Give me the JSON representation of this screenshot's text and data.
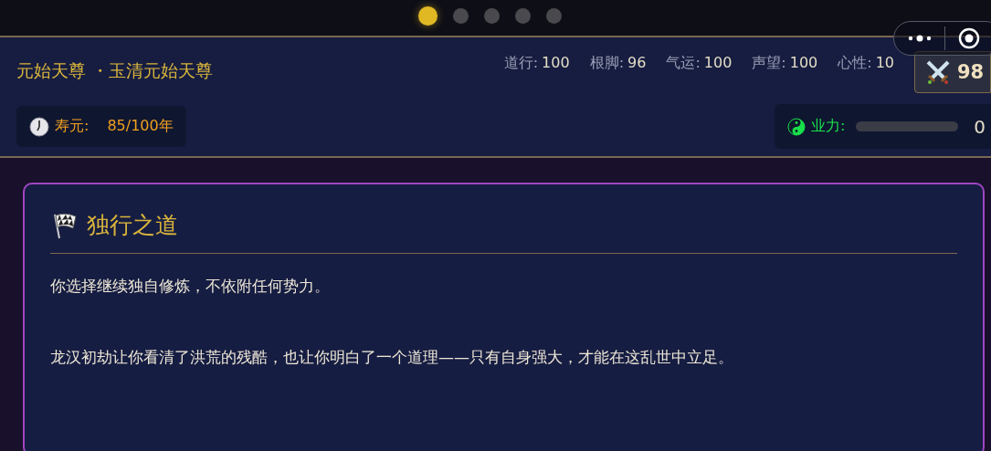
{
  "pager": {
    "pages": [
      {
        "selected": true
      },
      {
        "selected": false
      },
      {
        "selected": false
      },
      {
        "selected": false
      },
      {
        "selected": false
      }
    ]
  },
  "header": {
    "title": "元始天尊 ・玉清元始天尊",
    "stats": [
      {
        "label": "道行:",
        "value": "100"
      },
      {
        "label": "根脚:",
        "value": "96"
      },
      {
        "label": "气运:",
        "value": "100"
      },
      {
        "label": "声望:",
        "value": "100"
      },
      {
        "label": "心性:",
        "value": "10"
      }
    ],
    "power": "98",
    "lifespan": {
      "label": "寿元:",
      "value": "85/100年"
    },
    "karma": {
      "label": "业力:",
      "level": 0,
      "value": "0"
    }
  },
  "card": {
    "title": "独行之道",
    "paragraphs": [
      "你选择继续独自修炼，不依附任何势力。",
      "龙汉初劫让你看清了洪荒的残酷，也让你明白了一个道理——只有自身强大，才能在这乱世中立足。"
    ]
  }
}
